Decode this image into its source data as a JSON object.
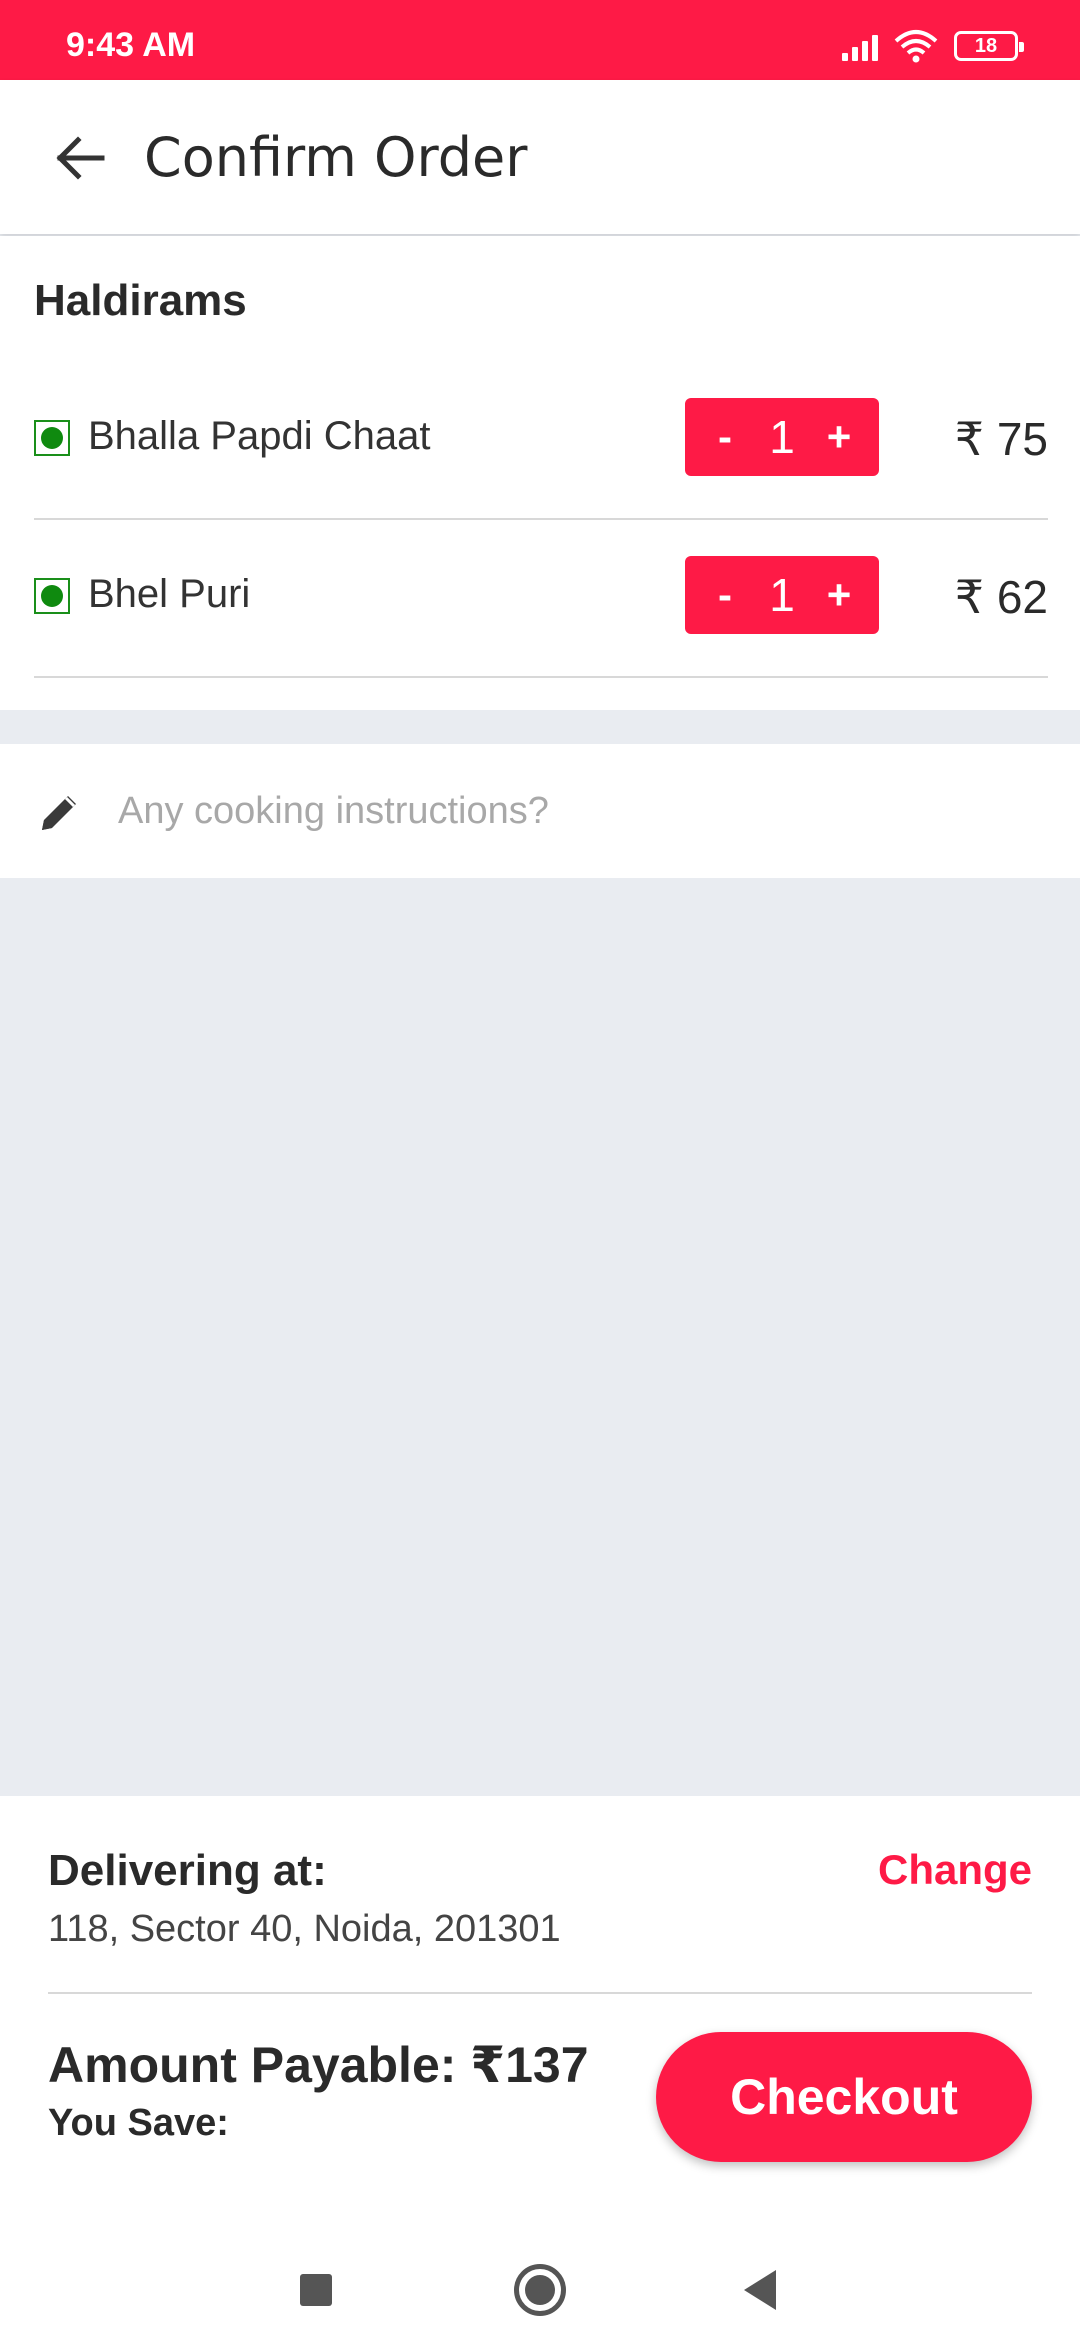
{
  "status_bar": {
    "time": "9:43 AM",
    "battery": "18",
    "icons": [
      "signal-icon",
      "wifi-icon",
      "battery-icon"
    ]
  },
  "header": {
    "title": "Confirm Order",
    "back_icon": "arrow-left-icon"
  },
  "order": {
    "restaurant": "Haldirams",
    "items": [
      {
        "name": "Bhalla Papdi Chaat",
        "quantity": "1",
        "price": "₹ 75",
        "minus": "-",
        "plus": "+"
      },
      {
        "name": "Bhel Puri",
        "quantity": "1",
        "price": "₹ 62",
        "minus": "-",
        "plus": "+"
      }
    ]
  },
  "instructions": {
    "placeholder": "Any cooking instructions?",
    "value": "",
    "icon": "pencil-icon"
  },
  "delivery": {
    "label": "Delivering at:",
    "change_label": "Change",
    "address": "118, Sector 40, Noida, 201301"
  },
  "payment": {
    "amount_label": "Amount Payable: ₹137",
    "save_label": "You Save:",
    "checkout_label": "Checkout"
  },
  "colors": {
    "accent": "#fe1a46",
    "veg": "#0f8a0f",
    "background": "#e9ecf1"
  }
}
